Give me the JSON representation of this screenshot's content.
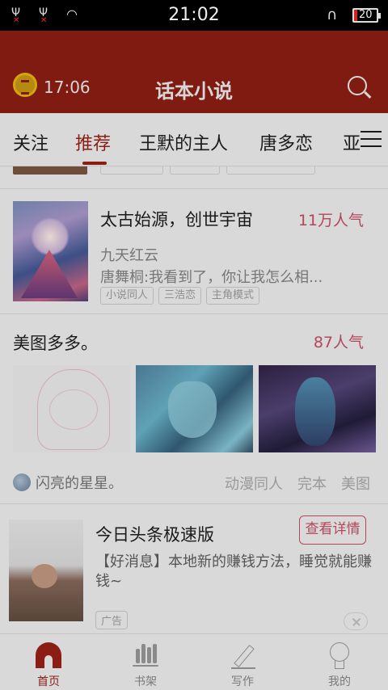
{
  "status_bar": {
    "time": "21:02",
    "battery": "20",
    "sim1_icon": "signal-1-no-service-icon",
    "sim2_icon": "signal-2-no-service-icon",
    "wifi_icon": "wifi-icon",
    "headset_icon": "headset-icon"
  },
  "header": {
    "title": "话本小说",
    "time": "17:06",
    "coin_icon": "coin-icon",
    "search_icon": "search-icon",
    "brand_color": "#8a1e14"
  },
  "tabs": [
    {
      "label": "关注"
    },
    {
      "label": "推荐"
    },
    {
      "label": "王默的主人"
    },
    {
      "label": "唐多恋"
    },
    {
      "label": "亚"
    }
  ],
  "active_tab": "推荐",
  "book": {
    "title": "太古始源，创世宇宙",
    "popularity": "11万人气",
    "author": "九天红云",
    "excerpt": "唐舞桐:我看到了，你让我怎么相...",
    "tags": [
      "小说同人",
      "三浩恋",
      "主角模式"
    ]
  },
  "gallery": {
    "title": "美图多多。",
    "popularity": "87人气",
    "user": "闪亮的星星。",
    "tags": [
      "动漫同人",
      "完本",
      "美图"
    ]
  },
  "ad": {
    "title": "今日头条极速版",
    "button": "查看详情",
    "description": "【好消息】本地新的赚钱方法，睡觉就能赚钱~",
    "label": "广告",
    "close_icon": "close-icon"
  },
  "bottom_nav": [
    {
      "label": "首页",
      "icon": "home-icon"
    },
    {
      "label": "书架",
      "icon": "bookshelf-icon"
    },
    {
      "label": "写作",
      "icon": "pen-icon"
    },
    {
      "label": "我的",
      "icon": "profile-icon"
    }
  ]
}
